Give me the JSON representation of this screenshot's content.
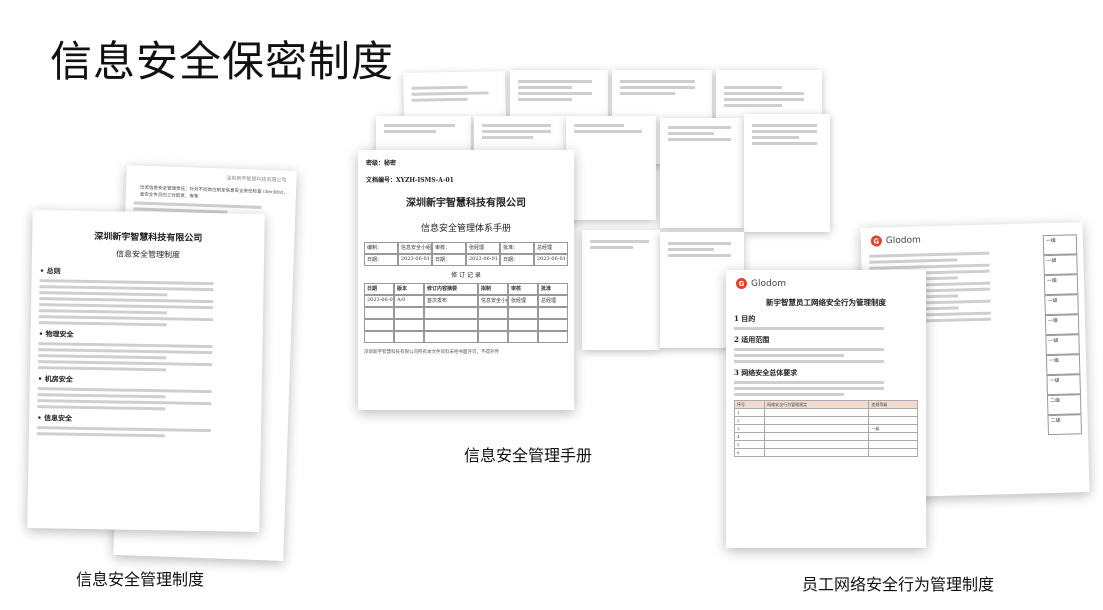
{
  "page": {
    "title": "信息安全保密制度"
  },
  "captions": {
    "policy": "信息安全管理制度",
    "manual": "信息安全管理手册",
    "behavior": "员工网络安全行为管理制度"
  },
  "policy_doc": {
    "header": "深圳新宇智慧科技有限公司",
    "company": "深圳新宇智慧科技有限公司",
    "subtitle": "信息安全管理制度",
    "sections": [
      "• 总则",
      "• 物理安全",
      "• 机房安全",
      "• 信息安全"
    ],
    "back_line1": "历览信息安全管理责任，针对不同岗位制定信息安全责任检查 checklist，信",
    "back_line2": "息安全专员的工作职责，等等"
  },
  "manual_doc": {
    "secret": "密级：秘密",
    "doc_no": "文档编号：XYZH-ISMS-A-01",
    "company": "深圳新宇智慧科技有限公司",
    "title": "信息安全管理体系手册",
    "record_title": "修 订 记 录",
    "row1": [
      "编制：",
      "信息安全小组",
      "审核：",
      "张经理",
      "批准：",
      "总经理"
    ],
    "row2": [
      "日期：",
      "2023-06-01",
      "日期：",
      "2023-06-01",
      "日期：",
      "2023-06-01"
    ],
    "rev_header": [
      "日期",
      "版本",
      "修订内容摘要",
      "拟制",
      "审核",
      "批准"
    ],
    "rev_row": [
      "2023-06-01",
      "A/0",
      "首次发布",
      "信息安全小组",
      "张经理",
      "总经理"
    ],
    "footer": "深圳新宇智慧科技有限公司所有本文件资料未经书面许可，不得外传"
  },
  "behavior_doc": {
    "brand": "Glodom",
    "title": "新宇智慧员工网络安全行为管理制度",
    "sections": [
      "1 目的",
      "2 适用范围",
      "3 网络安全总体要求"
    ],
    "table_header": [
      "序号",
      "网络安全行为管理规定",
      "违规等级"
    ],
    "table_rows": [
      "1",
      "2",
      "3",
      "4",
      "5",
      "6"
    ],
    "level": "一级"
  },
  "back_doc": {
    "brand": "Glodom",
    "levels": [
      "一级",
      "一级",
      "一级",
      "一级",
      "一级",
      "一级",
      "一级",
      "一级",
      "二级",
      "二级"
    ]
  }
}
